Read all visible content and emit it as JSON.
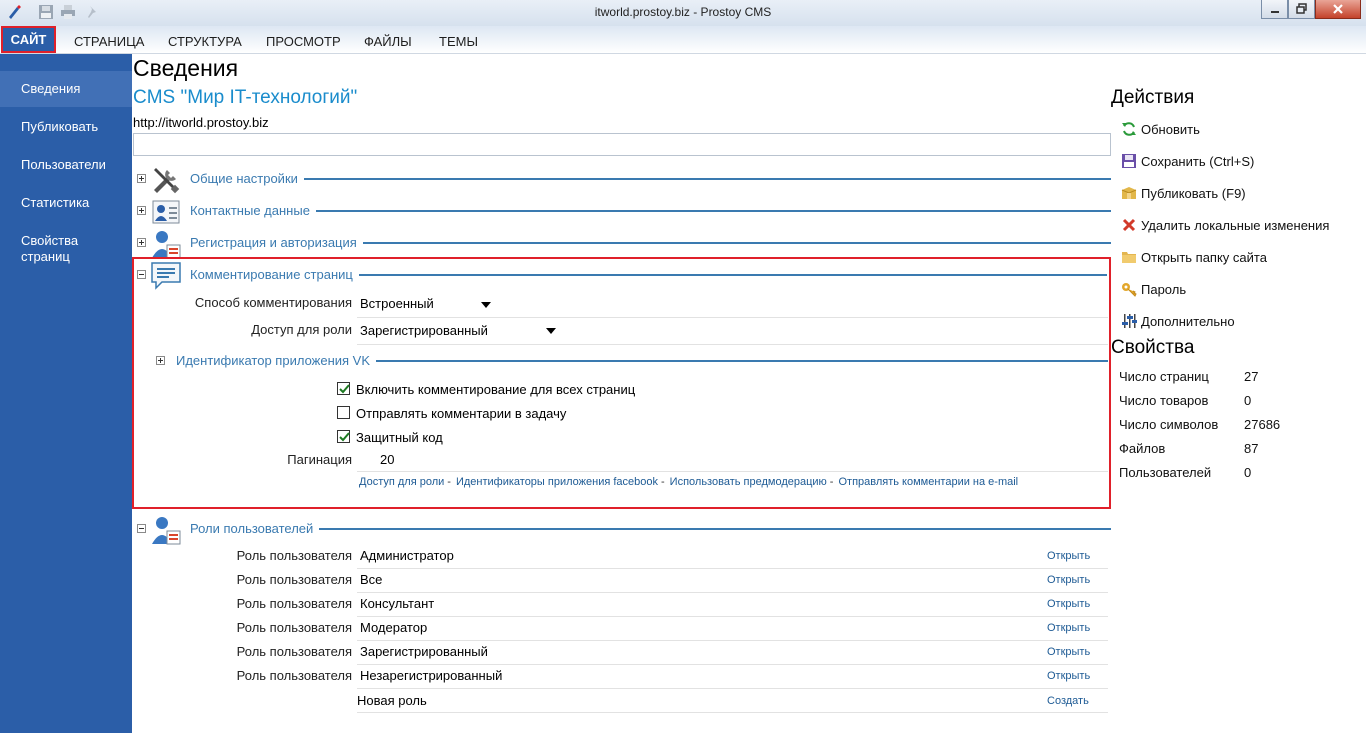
{
  "window": {
    "title": "itworld.prostoy.biz - Prostoy CMS"
  },
  "menu": {
    "site": "САЙТ",
    "items": [
      "СТРАНИЦА",
      "СТРУКТУРА",
      "ПРОСМОТР",
      "ФАЙЛЫ",
      "ТЕМЫ"
    ]
  },
  "sidebar": {
    "items": [
      {
        "label": "Сведения",
        "active": true
      },
      {
        "label": "Публиковать"
      },
      {
        "label": "Пользователи"
      },
      {
        "label": "Статистика"
      },
      {
        "label": "Свойства страниц"
      }
    ]
  },
  "main": {
    "title": "Сведения",
    "site_name": "CMS \"Мир IT-технологий\"",
    "site_url": "http://itworld.prostoy.biz",
    "url_input_value": "",
    "sections": [
      {
        "label": "Общие настройки",
        "expanded": false
      },
      {
        "label": "Контактные данные",
        "expanded": false
      },
      {
        "label": "Регистрация и авторизация",
        "expanded": false
      },
      {
        "label": "Комментирование страниц",
        "expanded": true
      }
    ],
    "comments": {
      "method_label": "Способ комментирования",
      "method_value": "Встроенный",
      "access_label": "Доступ для роли",
      "access_value": "Зарегистрированный",
      "vk_label": "Идентификатор приложения VK",
      "checkboxes": [
        {
          "label": "Включить комментирование для всех страниц",
          "checked": true
        },
        {
          "label": "Отправлять комментарии в задачу",
          "checked": false
        },
        {
          "label": "Защитный код",
          "checked": true
        }
      ],
      "pagination_label": "Пагинация",
      "pagination_value": "20",
      "links": [
        "Доступ для роли",
        "Идентификаторы приложения facebook",
        "Использовать предмодерацию",
        "Отправлять комментарии на e-mail"
      ],
      "link_sep": "-"
    },
    "roles": {
      "section_label": "Роли пользователей",
      "row_label": "Роль пользователя",
      "open_label": "Открыть",
      "items": [
        "Администратор",
        "Все",
        "Консультант",
        "Модератор",
        "Зарегистрированный",
        "Незарегистрированный"
      ],
      "new_role": "Новая роль",
      "create_label": "Создать"
    }
  },
  "right": {
    "actions_title": "Действия",
    "actions": [
      {
        "label": "Обновить",
        "icon": "refresh-icon"
      },
      {
        "label": "Сохранить (Ctrl+S)",
        "icon": "save-icon"
      },
      {
        "label": "Публиковать (F9)",
        "icon": "publish-icon"
      },
      {
        "label": "Удалить локальные изменения",
        "icon": "delete-icon"
      },
      {
        "label": "Открыть папку сайта",
        "icon": "folder-icon"
      },
      {
        "label": "Пароль",
        "icon": "key-icon"
      },
      {
        "label": "Дополнительно",
        "icon": "sliders-icon"
      }
    ],
    "props_title": "Свойства",
    "props": [
      {
        "k": "Число страниц",
        "v": "27"
      },
      {
        "k": "Число товаров",
        "v": "0"
      },
      {
        "k": "Число символов",
        "v": "27686"
      },
      {
        "k": "Файлов",
        "v": "87"
      },
      {
        "k": "Пользователей",
        "v": "0"
      }
    ]
  },
  "colors": {
    "sidebar": "#2b5ea8",
    "accent": "#1a8ccc",
    "section_line": "#3a7ab0",
    "highlight": "#e0202a"
  }
}
